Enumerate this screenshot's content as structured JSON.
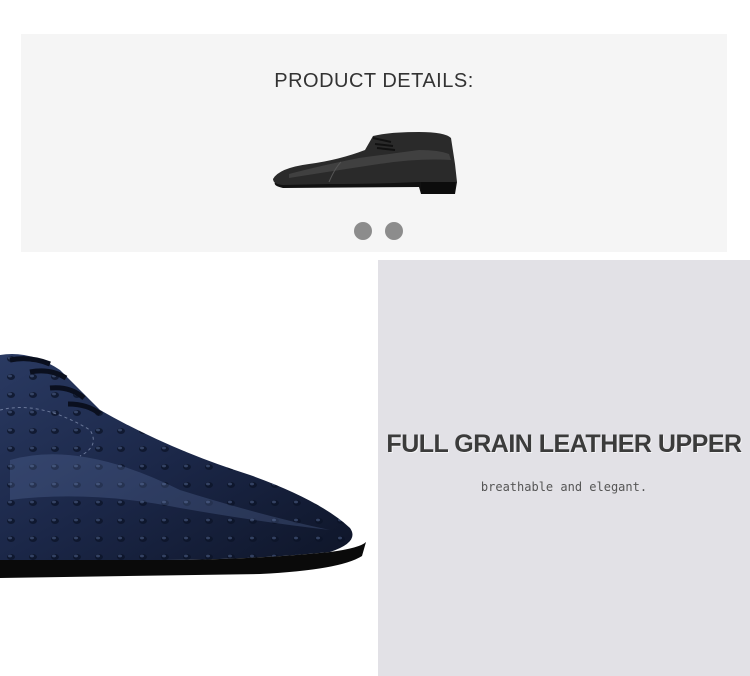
{
  "product_details": {
    "title": "PRODUCT DETAILS:",
    "thumbnail_icon": "black-oxford-shoe-image",
    "carousel": {
      "dots": [
        "slide-1",
        "slide-2"
      ],
      "dot_color": "#8c8c8c"
    },
    "background": "#f5f5f5"
  },
  "feature": {
    "image_icon": "blue-ostrich-leather-shoe-closeup",
    "title": "FULL GRAIN LEATHER UPPER",
    "subtitle": "breathable and elegant.",
    "panel_color": "#e2e1e6",
    "leather_color": "#1e2a4a"
  }
}
